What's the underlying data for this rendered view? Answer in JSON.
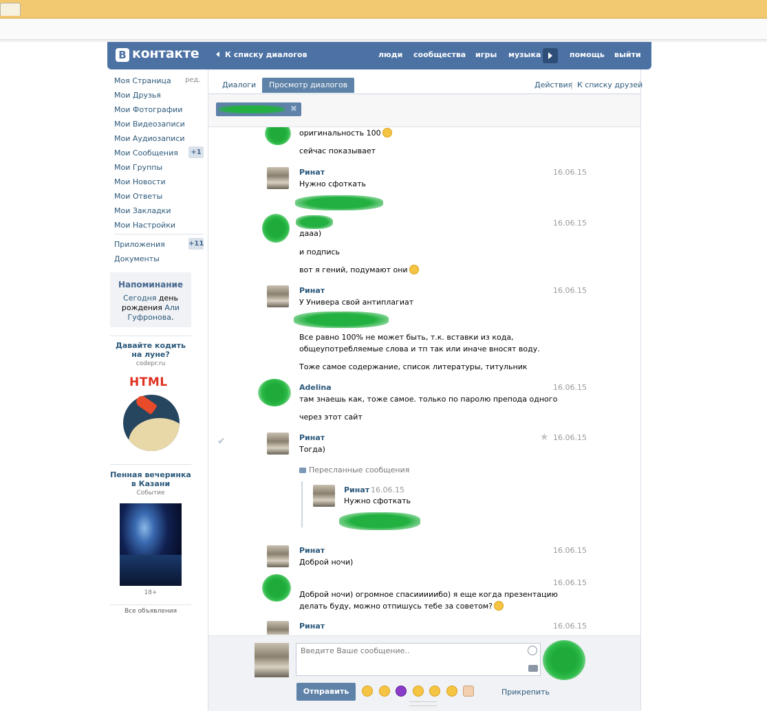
{
  "header": {
    "logo_mark": "B",
    "logo_text": "контакте",
    "back_link": "К списку диалогов",
    "nav": [
      "люди",
      "сообщества",
      "игры",
      "музыка",
      "помощь",
      "выйти"
    ]
  },
  "sidebar": {
    "items": [
      {
        "label": "Моя Страница",
        "extra": "ред."
      },
      {
        "label": "Мои Друзья"
      },
      {
        "label": "Мои Фотографии"
      },
      {
        "label": "Мои Видеозаписи"
      },
      {
        "label": "Мои Аудиозаписи"
      },
      {
        "label": "Мои Сообщения",
        "badge": "+1"
      },
      {
        "label": "Мои Группы"
      },
      {
        "label": "Мои Новости"
      },
      {
        "label": "Мои Ответы"
      },
      {
        "label": "Мои Закладки"
      },
      {
        "label": "Мои Настройки"
      }
    ],
    "apps": [
      {
        "label": "Приложения",
        "badge": "+11"
      },
      {
        "label": "Документы"
      }
    ]
  },
  "reminder": {
    "title": "Напоминание",
    "today": "Сегодня",
    "text1": " день",
    "text2": "рождения ",
    "name1": "Али",
    "name2": "Гуфронова",
    "dot": "."
  },
  "ads": [
    {
      "title": "Давайте кодить на луне?",
      "sub": "codepr.ru",
      "banner": "HTML"
    },
    {
      "title": "Пенная вечеринка в Казани",
      "sub": "Событие",
      "age": "18+"
    }
  ],
  "ads_all": "Все объявления",
  "tabs": {
    "items": [
      "Диалоги",
      "Просмотр диалогов"
    ],
    "actions": "Действия",
    "divider": "|",
    "friends": "К списку друзей"
  },
  "messages": [
    {
      "author": "",
      "date": "",
      "lines": [
        "оригинальность 100",
        "сейчас показывает"
      ]
    },
    {
      "author": "Ринат",
      "date": "16.06.15",
      "lines": [
        "Нужно сфоткать"
      ]
    },
    {
      "author": "",
      "date": "16.06.15",
      "lines": [
        "дааа)",
        "и подпись",
        "вот я гений, подумают они"
      ]
    },
    {
      "author": "Ринат",
      "date": "16.06.15",
      "lines": [
        "У Универа свой антиплагиат",
        "Все равно 100% не может быть, т.к. вставки из кода,",
        "общеупотребляемые слова и тп так или иначе вносят воду.",
        "Тоже самое содержание, список литературы, титульник"
      ]
    },
    {
      "author": "Adelina",
      "date": "16.06.15",
      "lines": [
        "там знаешь как, тоже самое. только по паролю препода одного",
        "через этот сайт"
      ]
    },
    {
      "author": "Ринат",
      "date": "16.06.15",
      "lines": [
        "Тогда)"
      ],
      "forwarded_label": "Пересланные сообщения",
      "forwarded": {
        "author": "Ринат",
        "date": "16.06.15",
        "text": "Нужно сфоткать"
      }
    },
    {
      "author": "Ринат",
      "date": "16.06.15",
      "lines": [
        "Доброй ночи)"
      ]
    },
    {
      "author": "",
      "date": "16.06.15",
      "lines": [
        "Доброй ночи) огромное спасииииибо) я еще когда презентацию",
        "делать буду, можно отпишусь тебе за советом?"
      ]
    },
    {
      "author": "Ринат",
      "date": "16.06.15",
      "lines": []
    }
  ],
  "compose": {
    "placeholder": "Введите Ваше сообщение..",
    "send": "Отправить",
    "attach": "Прикрепить"
  },
  "colors": {
    "brand": "#4c72a4",
    "link": "#2b587a",
    "button": "#5e82a8"
  }
}
